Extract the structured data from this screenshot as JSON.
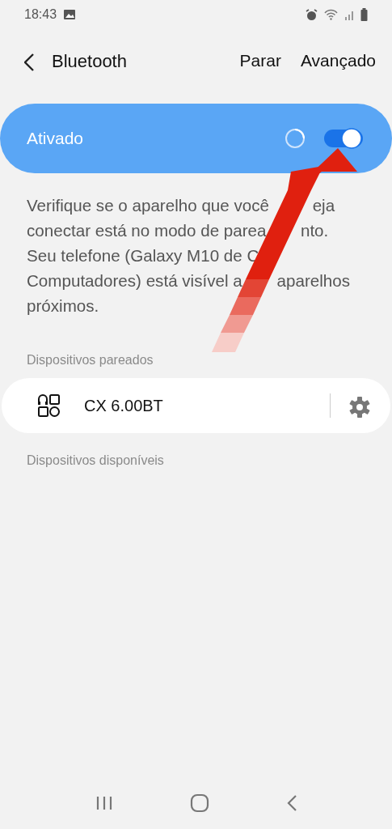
{
  "status_bar": {
    "time": "18:43"
  },
  "header": {
    "title": "Bluetooth",
    "actions": [
      "Parar",
      "Avançado"
    ]
  },
  "master_switch": {
    "label": "Ativado",
    "on": true,
    "scanning": true
  },
  "description": [
    {
      "parts": [
        "Verifique se o aparelho que você",
        "eja"
      ]
    },
    {
      "parts": [
        "conectar está no modo de parea",
        "nto."
      ]
    },
    {
      "parts": [
        "Seu telefone (Galaxy M10 de C"
      ]
    },
    {
      "parts": [
        "Computadores) está visível a",
        "aparelhos"
      ]
    },
    {
      "parts": [
        "próximos."
      ]
    }
  ],
  "sections": [
    {
      "title": "Dispositivos pareados",
      "devices": [
        {
          "name": "CX 6.00BT"
        }
      ]
    },
    {
      "title": "Dispositivos disponíveis"
    }
  ]
}
